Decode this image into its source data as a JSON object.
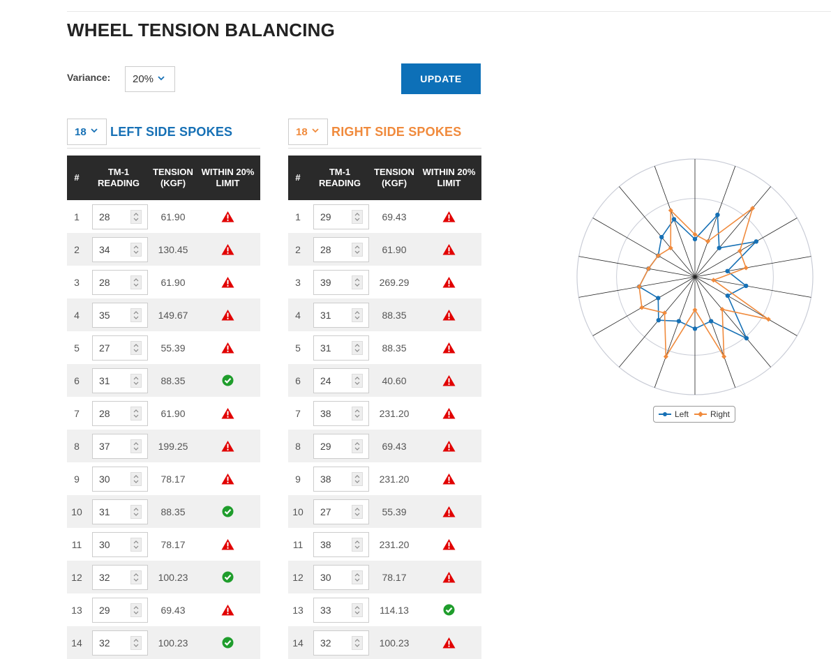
{
  "page": {
    "title": "WHEEL TENSION BALANCING"
  },
  "controls": {
    "variance_label": "Variance:",
    "variance_value": "20%",
    "update_label": "UPDATE"
  },
  "colors": {
    "left": "#1670b5",
    "right": "#f08a3c",
    "header_bg": "#2a2a2a",
    "button": "#0d70b8",
    "warn": "#e10000",
    "ok": "#1f9d2c"
  },
  "left": {
    "count": "18",
    "title": "LEFT SIDE SPOKES",
    "headers": [
      "#",
      "TM-1 READING",
      "TENSION (KGF)",
      "WITHIN 20% LIMIT"
    ],
    "rows": [
      {
        "n": "1",
        "reading": "28",
        "tension": "61.90",
        "ok": false
      },
      {
        "n": "2",
        "reading": "34",
        "tension": "130.45",
        "ok": false
      },
      {
        "n": "3",
        "reading": "28",
        "tension": "61.90",
        "ok": false
      },
      {
        "n": "4",
        "reading": "35",
        "tension": "149.67",
        "ok": false
      },
      {
        "n": "5",
        "reading": "27",
        "tension": "55.39",
        "ok": false
      },
      {
        "n": "6",
        "reading": "31",
        "tension": "88.35",
        "ok": true
      },
      {
        "n": "7",
        "reading": "28",
        "tension": "61.90",
        "ok": false
      },
      {
        "n": "8",
        "reading": "37",
        "tension": "199.25",
        "ok": false
      },
      {
        "n": "9",
        "reading": "30",
        "tension": "78.17",
        "ok": false
      },
      {
        "n": "10",
        "reading": "31",
        "tension": "88.35",
        "ok": true
      },
      {
        "n": "11",
        "reading": "30",
        "tension": "78.17",
        "ok": false
      },
      {
        "n": "12",
        "reading": "32",
        "tension": "100.23",
        "ok": true
      },
      {
        "n": "13",
        "reading": "29",
        "tension": "69.43",
        "ok": false
      },
      {
        "n": "14",
        "reading": "32",
        "tension": "100.23",
        "ok": true
      }
    ]
  },
  "right": {
    "count": "18",
    "title": "RIGHT SIDE SPOKES",
    "headers": [
      "#",
      "TM-1 READING",
      "TENSION (KGF)",
      "WITHIN 20% LIMIT"
    ],
    "rows": [
      {
        "n": "1",
        "reading": "29",
        "tension": "69.43",
        "ok": false
      },
      {
        "n": "2",
        "reading": "28",
        "tension": "61.90",
        "ok": false
      },
      {
        "n": "3",
        "reading": "39",
        "tension": "269.29",
        "ok": false
      },
      {
        "n": "4",
        "reading": "31",
        "tension": "88.35",
        "ok": false
      },
      {
        "n": "5",
        "reading": "31",
        "tension": "88.35",
        "ok": false
      },
      {
        "n": "6",
        "reading": "24",
        "tension": "40.60",
        "ok": false
      },
      {
        "n": "7",
        "reading": "38",
        "tension": "231.20",
        "ok": false
      },
      {
        "n": "8",
        "reading": "29",
        "tension": "69.43",
        "ok": false
      },
      {
        "n": "9",
        "reading": "38",
        "tension": "231.20",
        "ok": false
      },
      {
        "n": "10",
        "reading": "27",
        "tension": "55.39",
        "ok": false
      },
      {
        "n": "11",
        "reading": "38",
        "tension": "231.20",
        "ok": false
      },
      {
        "n": "12",
        "reading": "30",
        "tension": "78.17",
        "ok": false
      },
      {
        "n": "13",
        "reading": "33",
        "tension": "114.13",
        "ok": true
      },
      {
        "n": "14",
        "reading": "32",
        "tension": "100.23",
        "ok": false
      }
    ]
  },
  "chart_data": {
    "type": "radar",
    "axes": 18,
    "series": [
      {
        "name": "Left",
        "values": [
          28,
          34,
          28,
          35,
          27,
          31,
          28,
          37,
          30,
          31,
          30,
          32,
          29,
          32,
          30,
          29,
          31,
          33
        ]
      },
      {
        "name": "Right",
        "values": [
          29,
          28,
          39,
          31,
          31,
          24,
          38,
          29,
          38,
          27,
          38,
          30,
          33,
          32,
          30,
          29,
          28,
          35
        ]
      }
    ],
    "legend_position": "bottom"
  },
  "legend": {
    "left": "Left",
    "right": "Right"
  }
}
